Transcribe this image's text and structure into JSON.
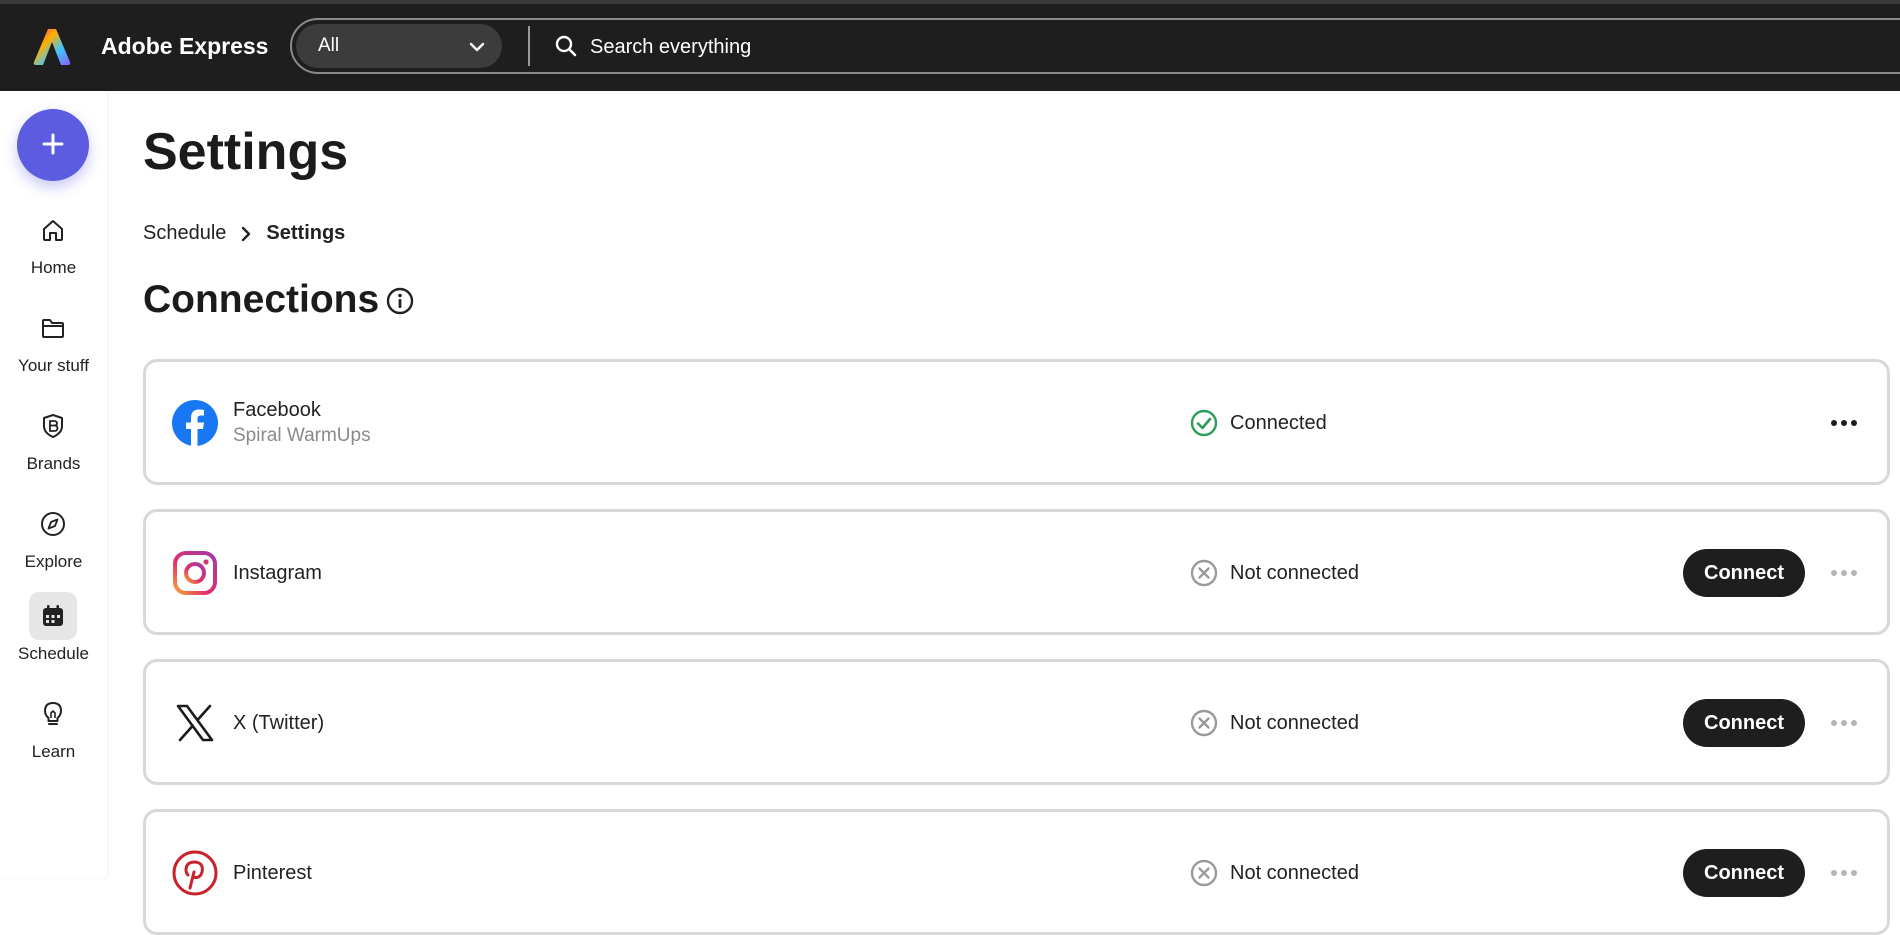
{
  "app": {
    "name": "Adobe Express"
  },
  "search": {
    "scope_value": "All",
    "placeholder": "Search everything"
  },
  "rail": {
    "create_label": "+",
    "items": [
      {
        "label": "Home",
        "icon": "home-icon"
      },
      {
        "label": "Your stuff",
        "icon": "folder-icon"
      },
      {
        "label": "Brands",
        "icon": "brand-icon"
      },
      {
        "label": "Explore",
        "icon": "compass-icon"
      },
      {
        "label": "Schedule",
        "icon": "calendar-icon",
        "active": true
      },
      {
        "label": "Learn",
        "icon": "lightbulb-icon"
      }
    ]
  },
  "page": {
    "title": "Settings",
    "breadcrumb": {
      "parent": "Schedule",
      "current": "Settings"
    },
    "section_title": "Connections"
  },
  "connections": [
    {
      "platform": "Facebook",
      "account": "Spiral WarmUps",
      "status": "Connected",
      "connect_label": ""
    },
    {
      "platform": "Instagram",
      "account": "",
      "status": "Not connected",
      "connect_label": "Connect"
    },
    {
      "platform": "X (Twitter)",
      "account": "",
      "status": "Not connected",
      "connect_label": "Connect"
    },
    {
      "platform": "Pinterest",
      "account": "",
      "status": "Not connected",
      "connect_label": "Connect"
    }
  ],
  "colors": {
    "topbar": "#1e1e1e",
    "create_button": "#5c5ce0",
    "connected": "#2d9d5a",
    "not_connected": "#9a9a9a",
    "facebook": "#1877f2",
    "pinterest": "#c8232c"
  }
}
